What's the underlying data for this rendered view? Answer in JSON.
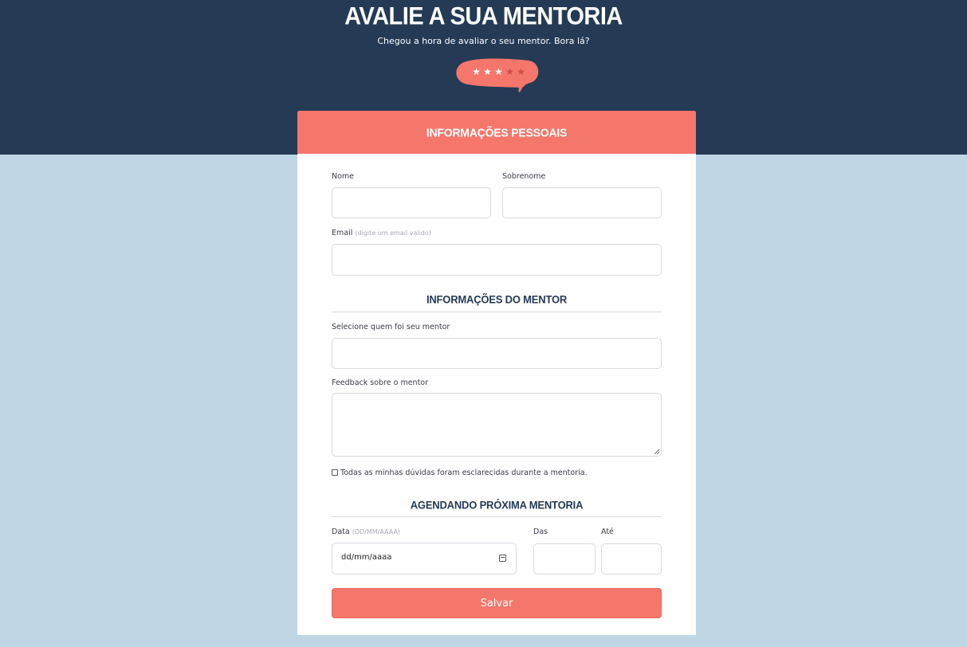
{
  "header": {
    "title": "AVALIE A SUA MENTORIA",
    "subtitle": "Chegou a hora de avaliar o seu mentor. Bora lá?",
    "rating": {
      "value": 3,
      "max": 5,
      "star_glyph": "★"
    },
    "bubble_color": "#f5766a",
    "background_color": "#243a55"
  },
  "personal": {
    "section_title": "INFORMAÇÕES PESSOAIS",
    "first_name_label": "Nome",
    "last_name_label": "Sobrenome",
    "email_label": "Email",
    "email_hint": "(digite um email valido)"
  },
  "mentor": {
    "section_title": "INFORMAÇÕES DO MENTOR",
    "select_label": "Selecione quem foi seu mentor",
    "feedback_label": "Feedback sobre o mentor",
    "checkbox_label": "Todas as minhas dúvidas foram esclarecidas durante a mentoria."
  },
  "schedule": {
    "section_title": "AGENDANDO PRÓXIMA MENTORIA",
    "date_label": "Data",
    "date_hint": "(DD/MM/AAAA)",
    "date_value": "dd/mm/aaaa",
    "from_label": "Das",
    "to_label": "Até"
  },
  "actions": {
    "save_label": "Salvar"
  },
  "colors": {
    "accent": "#f5766a",
    "navy": "#243a55",
    "page_background": "#bfd7e4"
  }
}
